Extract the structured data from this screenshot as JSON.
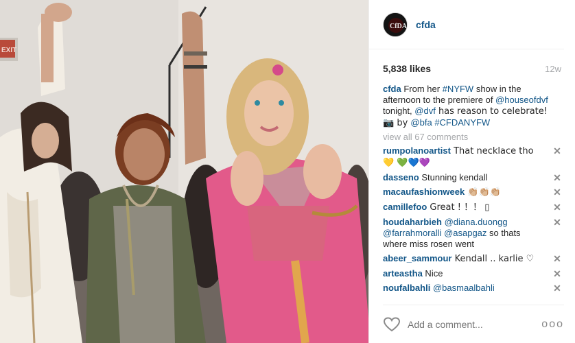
{
  "post": {
    "username": "cfda",
    "likes": "5,838 likes",
    "time": "12w"
  },
  "caption": {
    "user": "cfda",
    "t1": " From her ",
    "h1": "#NYFW",
    "t2": " show in the afternoon to the premiere of ",
    "h2": "@houseofdvf",
    "t3": " tonight, ",
    "h3": "@dvf",
    "t4": " has reason to celebrate! 📷 by ",
    "h4": "@bfa",
    "t5": " ",
    "h5": "#CFDANYFW"
  },
  "view_all": "view all 67 comments",
  "comments": [
    {
      "user": "rumpolanoartist",
      "text": " That necklace tho 💛 💚💙💜"
    },
    {
      "user": "dasseno",
      "text": " Stunning kendall"
    },
    {
      "user": "macaufashionweek",
      "text": " 👏🏼👏🏼👏🏼"
    },
    {
      "user": "camillefoo",
      "text": " Great ! ！！ ▯"
    },
    {
      "user": "houdaharbieh",
      "m1": " @diana.duongg",
      "m2": " @farrahmoralli",
      "m3": " @asapgaz",
      "text": " so thats where miss rosen went"
    },
    {
      "user": "abeer_sammour",
      "text": " Kendall .. karlie ♡"
    },
    {
      "user": "arteastha",
      "text": " Nice"
    },
    {
      "user": "noufalbahli",
      "m1": " @basmaalbahli"
    }
  ],
  "delete_glyph": "✕",
  "footer": {
    "placeholder": "Add a comment...",
    "more": "ooo"
  },
  "colors": {
    "link": "#125688",
    "muted": "#a5a7aa",
    "divider": "#efefef"
  }
}
